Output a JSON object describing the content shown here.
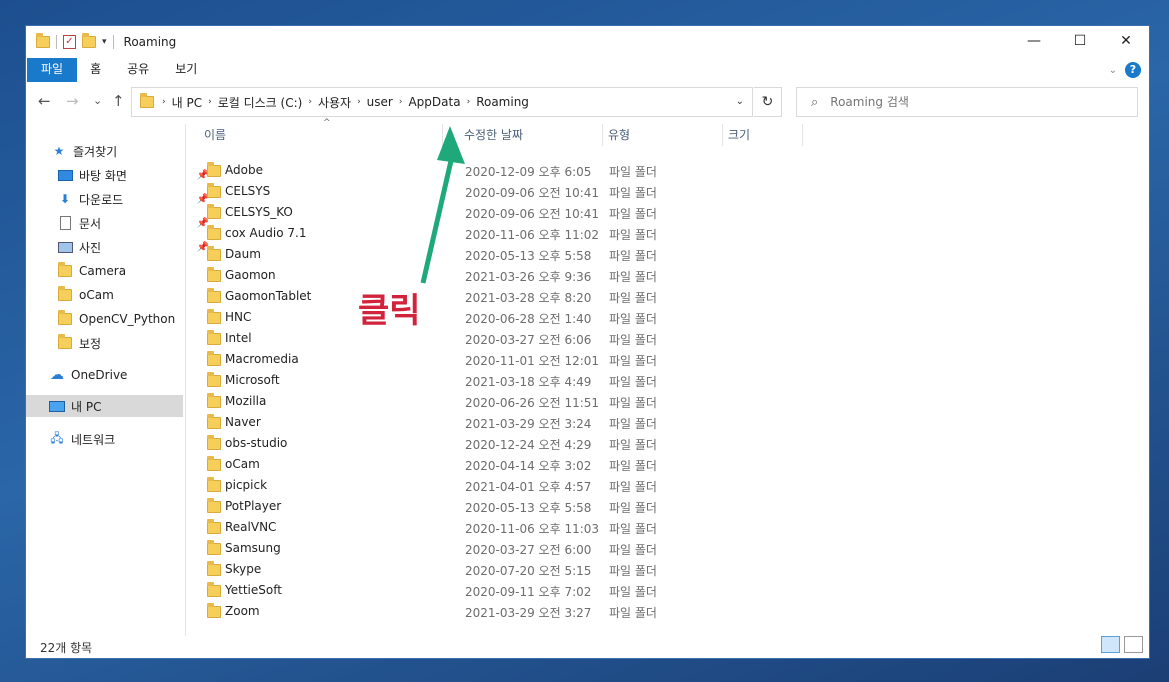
{
  "window": {
    "title": "Roaming"
  },
  "ribbon": {
    "tabs": [
      "파일",
      "홈",
      "공유",
      "보기"
    ]
  },
  "window_controls": {
    "minimize": "—",
    "maximize": "☐",
    "close": "✕"
  },
  "nav": {
    "back": "←",
    "forward": "→",
    "recent": "⌄",
    "up": "↑",
    "refresh": "↻"
  },
  "address": {
    "crumbs": [
      "내 PC",
      "로컬 디스크 (C:)",
      "사용자",
      "user",
      "AppData",
      "Roaming"
    ]
  },
  "search": {
    "placeholder": "Roaming 검색"
  },
  "sidebar": {
    "items": [
      {
        "label": "즐겨찾기",
        "icon": "star-icon"
      },
      {
        "label": "바탕 화면",
        "icon": "desktop-icon",
        "pinned": true
      },
      {
        "label": "다운로드",
        "icon": "download-icon",
        "pinned": true
      },
      {
        "label": "문서",
        "icon": "document-icon",
        "pinned": true
      },
      {
        "label": "사진",
        "icon": "pictures-icon",
        "pinned": true
      },
      {
        "label": "Camera",
        "icon": "folder-icon"
      },
      {
        "label": "oCam",
        "icon": "folder-icon"
      },
      {
        "label": "OpenCV_Python",
        "icon": "folder-icon"
      },
      {
        "label": "보정",
        "icon": "folder-icon"
      },
      {
        "label": "OneDrive",
        "icon": "cloud-icon"
      },
      {
        "label": "내 PC",
        "icon": "pc-icon",
        "selected": true
      },
      {
        "label": "네트워크",
        "icon": "network-icon"
      }
    ]
  },
  "columns": {
    "name": "이름",
    "date": "수정한 날짜",
    "type": "유형",
    "size": "크기"
  },
  "files": [
    {
      "name": "Adobe",
      "date": "2020-12-09 오후 6:05",
      "type": "파일 폴더"
    },
    {
      "name": "CELSYS",
      "date": "2020-09-06 오전 10:41",
      "type": "파일 폴더"
    },
    {
      "name": "CELSYS_KO",
      "date": "2020-09-06 오전 10:41",
      "type": "파일 폴더"
    },
    {
      "name": "cox Audio 7.1",
      "date": "2020-11-06 오후 11:02",
      "type": "파일 폴더"
    },
    {
      "name": "Daum",
      "date": "2020-05-13 오후 5:58",
      "type": "파일 폴더"
    },
    {
      "name": "Gaomon",
      "date": "2021-03-26 오후 9:36",
      "type": "파일 폴더"
    },
    {
      "name": "GaomonTablet",
      "date": "2021-03-28 오후 8:20",
      "type": "파일 폴더"
    },
    {
      "name": "HNC",
      "date": "2020-06-28 오전 1:40",
      "type": "파일 폴더"
    },
    {
      "name": "Intel",
      "date": "2020-03-27 오전 6:06",
      "type": "파일 폴더"
    },
    {
      "name": "Macromedia",
      "date": "2020-11-01 오전 12:01",
      "type": "파일 폴더"
    },
    {
      "name": "Microsoft",
      "date": "2021-03-18 오후 4:49",
      "type": "파일 폴더"
    },
    {
      "name": "Mozilla",
      "date": "2020-06-26 오전 11:51",
      "type": "파일 폴더"
    },
    {
      "name": "Naver",
      "date": "2021-03-29 오전 3:24",
      "type": "파일 폴더"
    },
    {
      "name": "obs-studio",
      "date": "2020-12-24 오전 4:29",
      "type": "파일 폴더"
    },
    {
      "name": "oCam",
      "date": "2020-04-14 오후 3:02",
      "type": "파일 폴더"
    },
    {
      "name": "picpick",
      "date": "2021-04-01 오후 4:57",
      "type": "파일 폴더"
    },
    {
      "name": "PotPlayer",
      "date": "2020-05-13 오후 5:58",
      "type": "파일 폴더"
    },
    {
      "name": "RealVNC",
      "date": "2020-11-06 오후 11:03",
      "type": "파일 폴더"
    },
    {
      "name": "Samsung",
      "date": "2020-03-27 오전 6:00",
      "type": "파일 폴더"
    },
    {
      "name": "Skype",
      "date": "2020-07-20 오전 5:15",
      "type": "파일 폴더"
    },
    {
      "name": "YettieSoft",
      "date": "2020-09-11 오후 7:02",
      "type": "파일 폴더"
    },
    {
      "name": "Zoom",
      "date": "2021-03-29 오전 3:27",
      "type": "파일 폴더"
    }
  ],
  "status": {
    "count": "22개 항목"
  },
  "annotation": {
    "text": "클릭",
    "color": "#d2233c",
    "arrow_color": "#1fa97a"
  }
}
